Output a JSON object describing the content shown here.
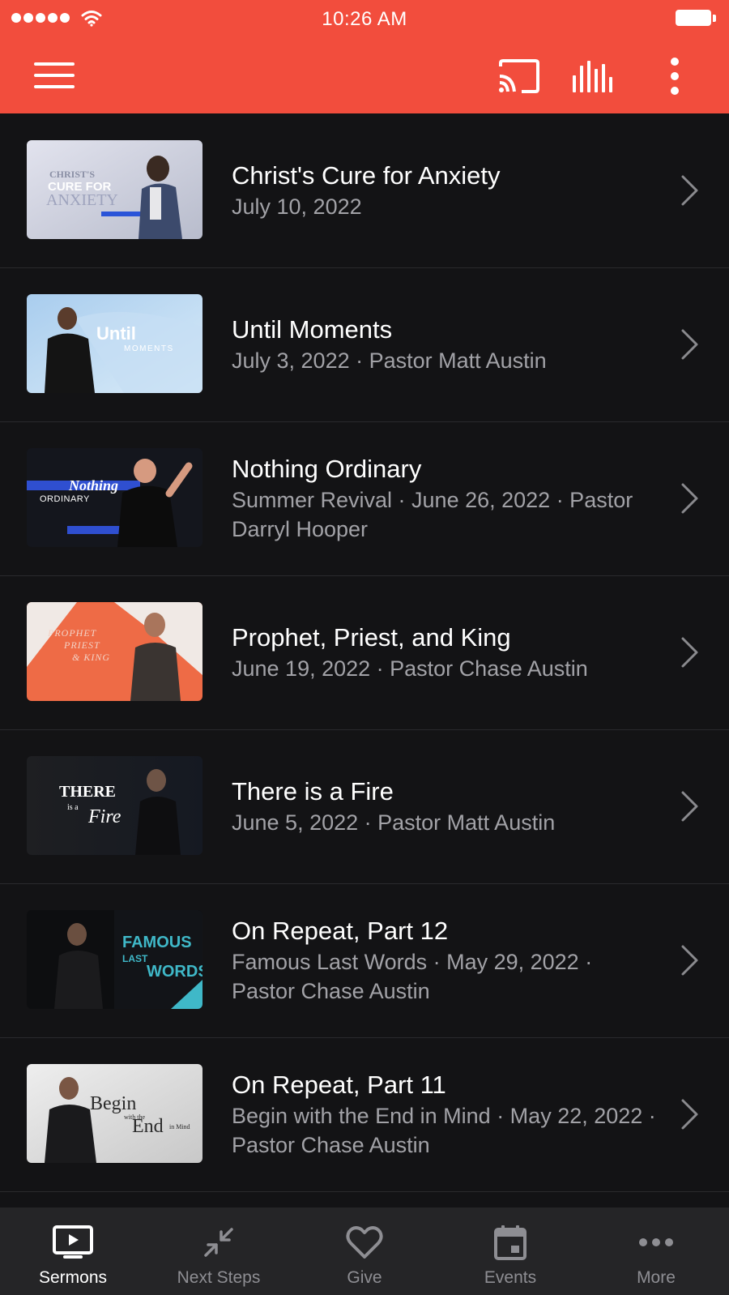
{
  "status_bar": {
    "time": "10:26 AM"
  },
  "app_bar": {
    "menu_icon": "hamburger-menu-icon",
    "cast_icon": "cast-icon",
    "stats_icon": "equalizer-icon",
    "more_icon": "vertical-dots-icon",
    "accent_color": "#f24d3d"
  },
  "sermons": [
    {
      "title": "Christ's Cure for Anxiety",
      "subtitle": "July 10, 2022",
      "thumb_text": "CHRIST'S CURE FOR ANXIETY"
    },
    {
      "title": "Until Moments",
      "subtitle": "July 3, 2022 · Pastor Matt Austin",
      "thumb_text": "Until MOMENTS"
    },
    {
      "title": "Nothing Ordinary",
      "subtitle": "Summer Revival · June 26, 2022 · Pastor Darryl Hooper",
      "thumb_text": "Nothing ORDINARY"
    },
    {
      "title": "Prophet, Priest, and King",
      "subtitle": "June 19, 2022 · Pastor Chase Austin",
      "thumb_text": "PROPHET PRIEST & KING"
    },
    {
      "title": "There is a Fire",
      "subtitle": "June 5, 2022 · Pastor Matt Austin",
      "thumb_text": "THERE is a Fire"
    },
    {
      "title": "On Repeat, Part 12",
      "subtitle": "Famous Last Words · May 29, 2022 · Pastor Chase Austin",
      "thumb_text": "FAMOUS LAST WORDS"
    },
    {
      "title": "On Repeat, Part 11",
      "subtitle": "Begin with the End in Mind · May 22, 2022 · Pastor Chase Austin",
      "thumb_text": "Begin with the End in Mind"
    }
  ],
  "tabs": [
    {
      "label": "Sermons",
      "icon": "video-screen-icon",
      "active": true
    },
    {
      "label": "Next Steps",
      "icon": "arrows-inward-icon",
      "active": false
    },
    {
      "label": "Give",
      "icon": "heart-icon",
      "active": false
    },
    {
      "label": "Events",
      "icon": "calendar-icon",
      "active": false
    },
    {
      "label": "More",
      "icon": "horizontal-dots-icon",
      "active": false
    }
  ]
}
